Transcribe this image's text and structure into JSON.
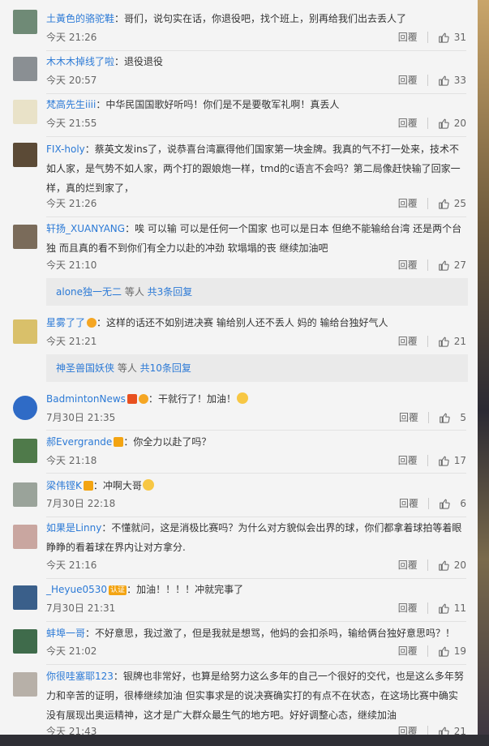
{
  "reply_label": "回覆",
  "comments": [
    {
      "user": "土黃色的骆驼鞋",
      "text": "哥们，说句实在话，你退役吧，找个班上，别再给我们出去丢人了",
      "time": "今天 21:26",
      "likes": "31",
      "avatar_color": "#6f8a76"
    },
    {
      "user": "木木木掉线了啦",
      "text": "退役退役",
      "time": "今天 20:57",
      "likes": "33",
      "avatar_color": "#8a8f93"
    },
    {
      "user": "梵高先生iiii",
      "text": "中华民国国歌好听吗！你们是不是要敬军礼啊！真丢人",
      "time": "今天 21:55",
      "likes": "20",
      "avatar_color": "#e9e2c8"
    },
    {
      "user": "FIX-holy",
      "text": "蔡英文发ins了，说恭喜台湾赢得他们国家第一块金牌。我真的气不打一处来，技术不如人家，是气势不如人家，两个打的跟娘炮一样，tmd的c语言不会吗？第二局像赶快输了回家一样，真的烂到家了，",
      "time": "今天 21:26",
      "likes": "25",
      "avatar_color": "#5b4a36"
    },
    {
      "user": "轩扬_XUANYANG",
      "text": "唉 可以输 可以是任何一个国家 也可以是日本 但绝不能输给台湾 还是两个台独  而且真的看不到你们有全力以赴的冲劲 软塌塌的丧 继续加油吧",
      "time": "今天 21:10",
      "likes": "27",
      "avatar_color": "#7a6b5a"
    },
    {
      "user": "星雾了了",
      "text": "这样的话还不如别进决赛 输给别人还不丢人 妈的 输给台独好气人",
      "time": "今天 21:21",
      "likes": "21",
      "avatar_color": "#d9c06a"
    },
    {
      "user": "BadmintonNews",
      "text": "干就行了！加油！",
      "time": "7月30日 21:35",
      "likes": "5",
      "avatar_color": "#2f6bc6"
    },
    {
      "user": "郝Evergrande",
      "text": "你全力以赴了吗？",
      "time": "今天 21:18",
      "likes": "17",
      "avatar_color": "#4f7a4a"
    },
    {
      "user": "梁伟铿K",
      "text": "冲啊大哥",
      "time": "7月30日 22:18",
      "likes": "6",
      "avatar_color": "#9aa39a"
    },
    {
      "user": "如果是Linny",
      "text": "不懂就问，这是消极比赛吗？为什么对方貌似会出界的球，你们都拿着球拍等着眼睁睁的看着球在界内让对方拿分.",
      "time": "今天 21:16",
      "likes": "20",
      "avatar_color": "#c9a6a0"
    },
    {
      "user": "_Heyue0530",
      "text": "加油！！！！冲就完事了",
      "time": "7月30日 21:31",
      "likes": "11",
      "avatar_color": "#3a5f8a"
    },
    {
      "user": "蚌埠一哥",
      "text": "不好意思，我过激了，但是我就是想骂，他妈的会扣杀吗，输给俩台独好意思吗？！",
      "time": "今天 21:02",
      "likes": "19",
      "avatar_color": "#3f6b4b"
    },
    {
      "user": "你很哇塞耶123",
      "text": "银牌也非常好，也算是给努力这么多年的自己一个很好的交代，也是这么多年努力和辛苦的证明，很棒继续加油 但实事求是的说决赛确实打的有点不在状态，在这场比赛中确实没有展现出奥运精神，这才是广大群众最生气的地方吧。好好调整心态，继续加油",
      "time": "今天 21:43",
      "likes": "21",
      "avatar_color": "#b7b0a8"
    }
  ],
  "subreplies": [
    {
      "user": "alone独一无二",
      "mid": " 等人 ",
      "total": "共3条回复"
    },
    {
      "user": "神圣兽国妖侠",
      "mid": " 等人 ",
      "total": "共10条回复"
    }
  ],
  "badge_labels": {
    "heyue": "认证"
  }
}
